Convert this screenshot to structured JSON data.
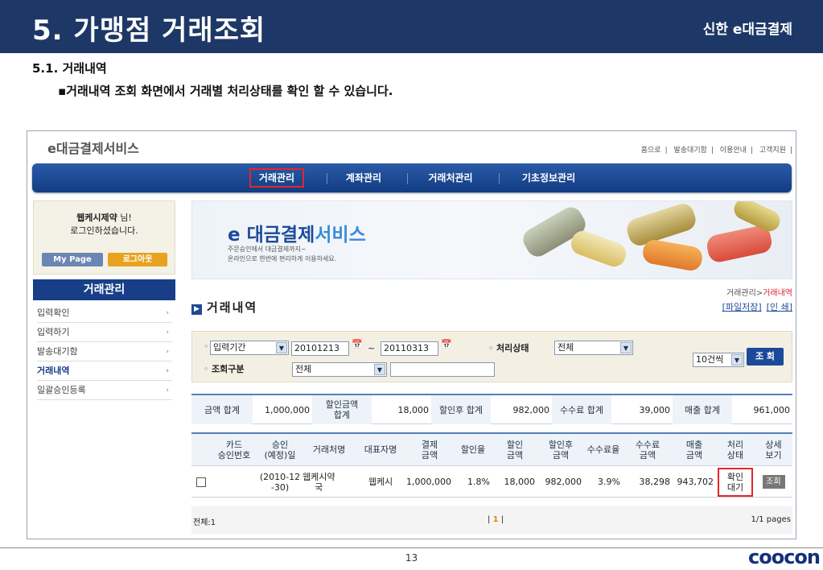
{
  "slide": {
    "title": "5. 가맹점 거래조회",
    "brand": "신한 e대금결제",
    "section": "5.1. 거래내역",
    "description": "▪거래내역 조회 화면에서 거래별 처리상태를 확인 할 수 있습니다.",
    "page_number": "13",
    "footer_logo": "coocon"
  },
  "app": {
    "logo": "e대금결제서비스",
    "toplinks": [
      "홈으로",
      "발송대기함",
      "이용안내",
      "고객지원"
    ],
    "nav": [
      "거래관리",
      "계좌관리",
      "거래처관리",
      "기초정보관리"
    ],
    "login": {
      "user": "웹케시제약",
      "suffix": " 님!",
      "message": "로그인하셨습니다.",
      "mypage": "My Page",
      "logout": "로그아웃"
    },
    "sidebar": {
      "title": "거래관리",
      "items": [
        "입력확인",
        "입력하기",
        "발송대기함",
        "거래내역",
        "일괄승인등록"
      ]
    },
    "banner": {
      "title_a": "e 대금결제",
      "title_b": "서비스",
      "line1": "주문승인에서 대금결제까지~",
      "line2": "온라인으로 한번에 편리하게 이용하세요."
    },
    "breadcrumb": {
      "parent": "거래관리",
      "sep": ">",
      "current": "거래내역"
    },
    "page_title": "거래내역",
    "page_title_icon": "▶",
    "page_links": [
      "[파일저장]",
      "[인 쇄]"
    ],
    "search": {
      "period_label": "입력기간",
      "date_from": "20101213",
      "tilde": "~",
      "date_to": "20110313",
      "status_label": "처리상태",
      "status_value": "전체",
      "type_label": "조회구분",
      "type_value": "전체",
      "type_text": "",
      "page_size": "10건씩",
      "search_button": "조 회"
    },
    "summary": [
      {
        "k": "금액 합계",
        "v": "1,000,000"
      },
      {
        "k": "할인금액\n합계",
        "v": "18,000"
      },
      {
        "k": "할인후 합계",
        "v": "982,000"
      },
      {
        "k": "수수료 합계",
        "v": "39,000"
      },
      {
        "k": "매출 합계",
        "v": "961,000"
      }
    ],
    "table": {
      "headers": [
        "",
        "카드\n승인번호",
        "승인\n(예정)일",
        "거래처명",
        "대표자명",
        "결제\n금액",
        "할인율",
        "할인\n금액",
        "할인후\n금액",
        "수수료율",
        "수수료\n금액",
        "매출\n금액",
        "처리\n상태",
        "상세\n보기"
      ],
      "row": {
        "card_no": "",
        "date": "(2010-12\n-30)",
        "client": "웹케시약\n국",
        "rep": "웹케시",
        "amount": "1,000,000",
        "discount_rate": "1.8%",
        "discount_amt": "18,000",
        "after": "982,000",
        "fee_rate": "3.9%",
        "fee_amt": "38,298",
        "sales": "943,702",
        "status": "확인\n대기",
        "detail": "조회"
      }
    },
    "pager": {
      "total": "전체:1",
      "pages_left": "|",
      "current": "1",
      "pages_right": "|",
      "info": "1/1 pages"
    }
  }
}
